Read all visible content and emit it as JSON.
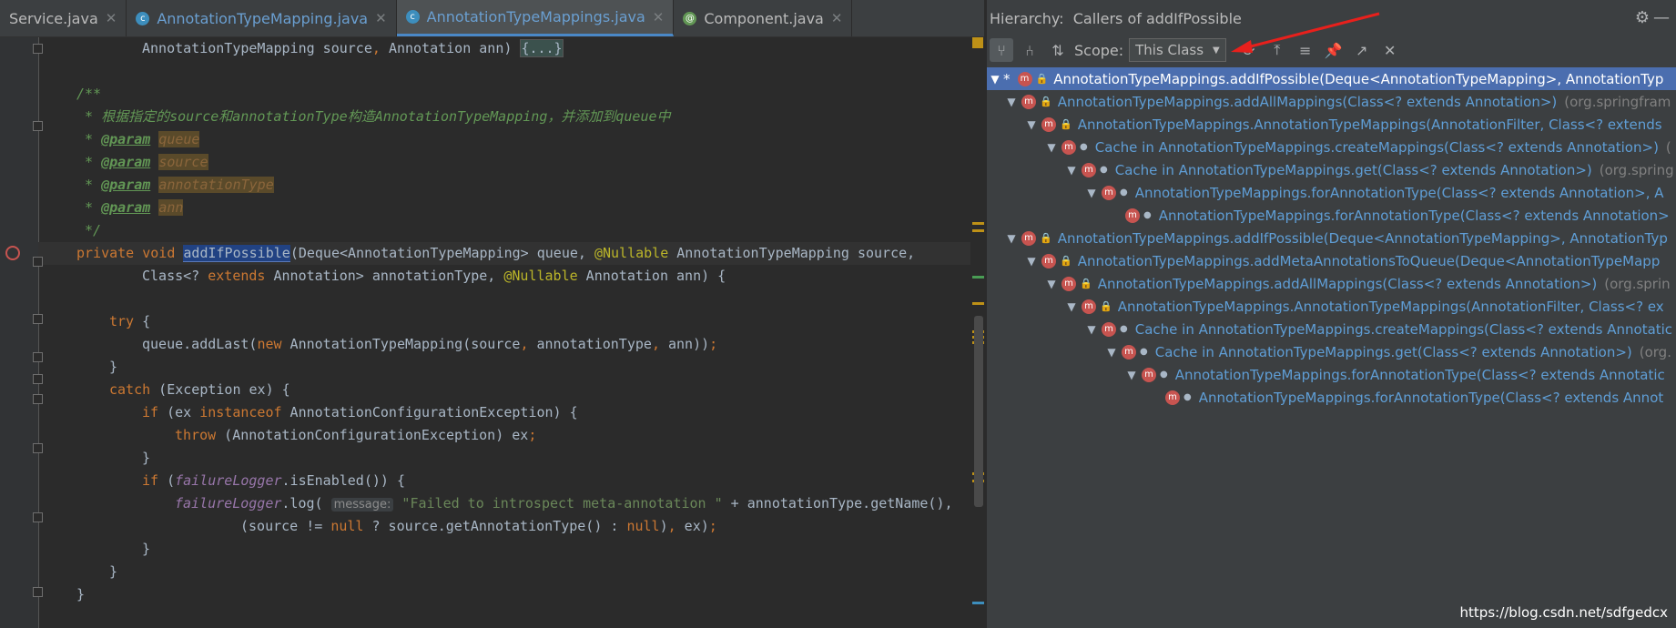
{
  "tabs": [
    {
      "name": "Service.java",
      "icon": "none"
    },
    {
      "name": "AnnotationTypeMapping.java",
      "icon": "class"
    },
    {
      "name": "AnnotationTypeMappings.java",
      "icon": "class",
      "active": true
    },
    {
      "name": "Component.java",
      "icon": "annotation"
    }
  ],
  "code": {
    "l1": [
      "AnnotationTypeMapping source",
      "Annotation ann) ",
      "{...}"
    ],
    "l3": "/**",
    "l4": " * 根据指定的source和annotationType构造AnnotationTypeMapping，并添加到queue中",
    "l5": [
      "@param",
      "queue"
    ],
    "l6": [
      "@param",
      "source"
    ],
    "l7": [
      "@param",
      "annotationType"
    ],
    "l8": [
      "@param",
      "ann"
    ],
    "l9": " */",
    "l10": [
      "private void ",
      "addIfPossible",
      "(Deque<AnnotationTypeMapping> queue, ",
      "@Nullable",
      " AnnotationTypeMapping source,"
    ],
    "l11": [
      "Class<? ",
      "extends",
      " Annotation> annotationType, ",
      "@Nullable",
      " Annotation ann) {"
    ],
    "l13": [
      "try",
      " {"
    ],
    "l14": [
      "queue.addLast(",
      "new",
      " AnnotationTypeMapping(source",
      ", ",
      "annotationType",
      ", ",
      "ann))",
      ";"
    ],
    "l15": "}",
    "l16": [
      "catch",
      " (Exception ex) {"
    ],
    "l17": [
      "if",
      " (ex ",
      "instanceof",
      " AnnotationConfigurationException) {"
    ],
    "l18": [
      "throw",
      " (AnnotationConfigurationException) ex",
      ";"
    ],
    "l19": "}",
    "l20": [
      "if",
      " (",
      "failureLogger",
      ".isEnabled()) {"
    ],
    "l21": [
      "failureLogger",
      ".log( ",
      "message:",
      " \"Failed to introspect meta-annotation \"",
      " + annotationType.getName(),"
    ],
    "l22": [
      "(source != ",
      "null",
      " ? source.getAnnotationType() : ",
      "null",
      ")",
      ", ",
      "ex)",
      ";"
    ],
    "l23": "}",
    "l24": "}",
    "l25": "}"
  },
  "hierarchy": {
    "title": "Hierarchy:",
    "subtitle": "Callers of addIfPossible",
    "scope_label": "Scope:",
    "scope_value": "This Class",
    "nodes": [
      {
        "text": "AnnotationTypeMappings.addIfPossible(Deque<AnnotationTypeMapping>, AnnotationTyp",
        "pkg": ""
      },
      {
        "text": "AnnotationTypeMappings.addAllMappings(Class<? extends Annotation>)",
        "pkg": "(org.springfram"
      },
      {
        "text": "AnnotationTypeMappings.AnnotationTypeMappings(AnnotationFilter, Class<? extends",
        "pkg": ""
      },
      {
        "text": "Cache in AnnotationTypeMappings.createMappings(Class<? extends Annotation>)",
        "pkg": "("
      },
      {
        "text": "Cache in AnnotationTypeMappings.get(Class<? extends Annotation>)",
        "pkg": "(org.spring"
      },
      {
        "text": "AnnotationTypeMappings.forAnnotationType(Class<? extends Annotation>, A",
        "pkg": ""
      },
      {
        "text": "AnnotationTypeMappings.forAnnotationType(Class<? extends Annotation>",
        "pkg": ""
      },
      {
        "text": "AnnotationTypeMappings.addIfPossible(Deque<AnnotationTypeMapping>, AnnotationTyp",
        "pkg": ""
      },
      {
        "text": "AnnotationTypeMappings.addMetaAnnotationsToQueue(Deque<AnnotationTypeMapp",
        "pkg": ""
      },
      {
        "text": "AnnotationTypeMappings.addAllMappings(Class<? extends Annotation>)",
        "pkg": "(org.sprin"
      },
      {
        "text": "AnnotationTypeMappings.AnnotationTypeMappings(AnnotationFilter, Class<? ex",
        "pkg": ""
      },
      {
        "text": "Cache in AnnotationTypeMappings.createMappings(Class<? extends Annotatic",
        "pkg": ""
      },
      {
        "text": "Cache in AnnotationTypeMappings.get(Class<? extends Annotation>)",
        "pkg": "(org."
      },
      {
        "text": "AnnotationTypeMappings.forAnnotationType(Class<? extends Annotatic",
        "pkg": ""
      },
      {
        "text": "AnnotationTypeMappings.forAnnotationType(Class<? extends Annot",
        "pkg": ""
      }
    ]
  },
  "watermark": "https://blog.csdn.net/sdfgedcx"
}
